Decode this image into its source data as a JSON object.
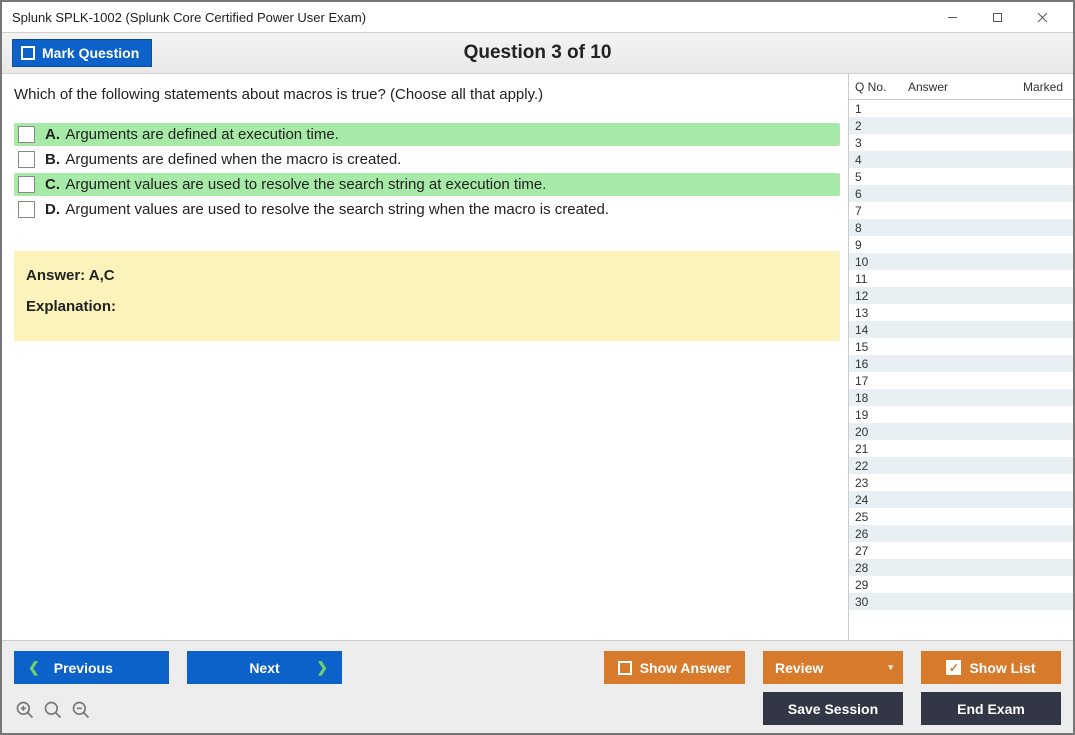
{
  "window": {
    "title": "Splunk SPLK-1002 (Splunk Core Certified Power User Exam)"
  },
  "header": {
    "mark_label": "Mark Question",
    "question_title": "Question 3 of 10"
  },
  "question": {
    "text": "Which of the following statements about macros is true? (Choose all that apply.)",
    "options": [
      {
        "letter": "A.",
        "text": "Arguments are defined at execution time.",
        "correct": true
      },
      {
        "letter": "B.",
        "text": "Arguments are defined when the macro is created.",
        "correct": false
      },
      {
        "letter": "C.",
        "text": "Argument values are used to resolve the search string at execution time.",
        "correct": true
      },
      {
        "letter": "D.",
        "text": "Argument values are used to resolve the search string when the macro is created.",
        "correct": false
      }
    ],
    "answer_label": "Answer: A,C",
    "explanation_label": "Explanation:"
  },
  "sidebar": {
    "col_qno": "Q No.",
    "col_answer": "Answer",
    "col_marked": "Marked",
    "rows": [
      1,
      2,
      3,
      4,
      5,
      6,
      7,
      8,
      9,
      10,
      11,
      12,
      13,
      14,
      15,
      16,
      17,
      18,
      19,
      20,
      21,
      22,
      23,
      24,
      25,
      26,
      27,
      28,
      29,
      30
    ]
  },
  "buttons": {
    "previous": "Previous",
    "next": "Next",
    "show_answer": "Show Answer",
    "review": "Review",
    "show_list": "Show List",
    "save_session": "Save Session",
    "end_exam": "End Exam"
  }
}
